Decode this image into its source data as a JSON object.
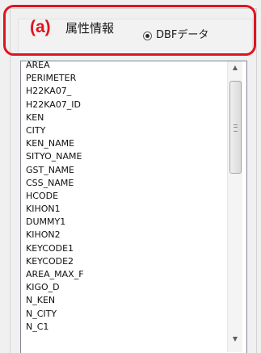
{
  "attribute_panel": {
    "annotation_label": "(a)",
    "title": "属性情報",
    "radio_option_label": "DBFデータ",
    "radio_selected": true
  },
  "field_list": {
    "items": [
      "AREA",
      "PERIMETER",
      "H22KA07_",
      "H22KA07_ID",
      "KEN",
      "CITY",
      "KEN_NAME",
      "SITYO_NAME",
      "GST_NAME",
      "CSS_NAME",
      "HCODE",
      "KIHON1",
      "DUMMY1",
      "KIHON2",
      "KEYCODE1",
      "KEYCODE2",
      "AREA_MAX_F",
      "KIGO_D",
      "N_KEN",
      "N_CITY",
      "N_C1"
    ]
  },
  "scrollbar": {
    "up_icon": "triangle-up",
    "down_icon": "triangle-down",
    "grip_icon": "grip-lines"
  },
  "colors": {
    "highlight": "#e0141e",
    "background": "#f0f0f0",
    "list_background": "#ffffff"
  }
}
